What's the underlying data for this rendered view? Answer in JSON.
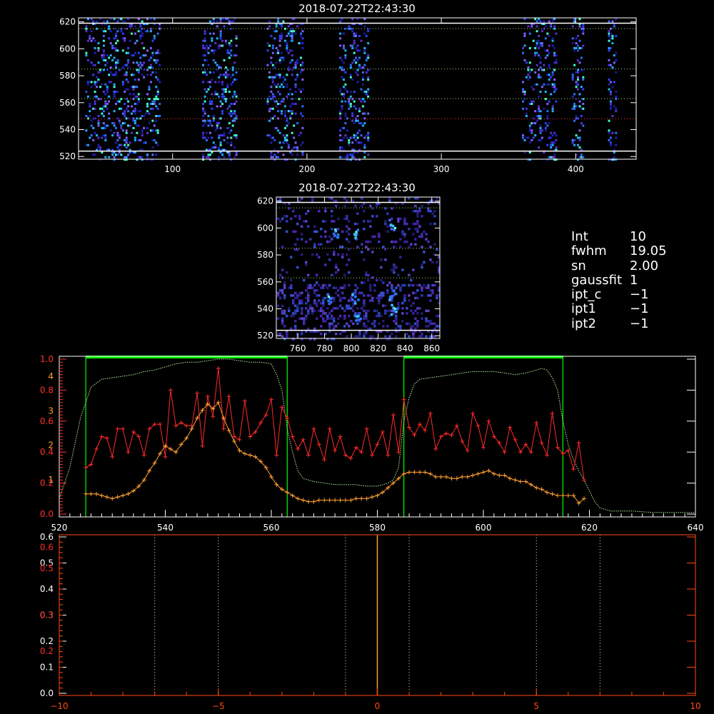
{
  "colors": {
    "background": "#000000",
    "frame": "#ffffff",
    "red_curve": "#ff2a2a",
    "orange_curve": "#ffa030",
    "green_curve": "#00ff00",
    "lower_frame": "#ff4a10"
  },
  "params": [
    {
      "name": "Int",
      "value": "10"
    },
    {
      "name": "fwhm",
      "value": "19.05"
    },
    {
      "name": "sn",
      "value": "2.00"
    },
    {
      "name": "gaussfit",
      "value": "1"
    },
    {
      "name": "ipt_c",
      "value": "−1"
    },
    {
      "name": "ipt1",
      "value": "−1"
    },
    {
      "name": "ipt2",
      "value": "−1"
    }
  ],
  "chart_data": [
    {
      "type": "heatmap",
      "title": "2018-07-22T22:43:30",
      "xlim": [
        30,
        445
      ],
      "ylim": [
        518,
        623
      ],
      "xticks": [
        100,
        200,
        300,
        400
      ],
      "yticks": [
        520,
        540,
        560,
        580,
        600,
        620
      ],
      "active_x_bands": [
        [
          35,
          90
        ],
        [
          122,
          148
        ],
        [
          170,
          197
        ],
        [
          224,
          245
        ],
        [
          360,
          385
        ],
        [
          397,
          405
        ],
        [
          424,
          430
        ]
      ],
      "hlines_solid": [
        524,
        619
      ],
      "hlines_dotted": [
        585,
        563,
        615
      ],
      "hline_red": 548
    },
    {
      "type": "heatmap",
      "title": "2018-07-22T22:43:30",
      "xlim": [
        744,
        866
      ],
      "ylim": [
        518,
        623
      ],
      "xticks": [
        760,
        780,
        800,
        820,
        840,
        860
      ],
      "yticks": [
        520,
        540,
        560,
        580,
        600,
        620
      ],
      "hlines_solid": [
        524,
        619
      ],
      "hlines_dotted": [
        585,
        563,
        615
      ]
    },
    {
      "type": "line",
      "xlim": [
        520,
        640
      ],
      "ylim": [
        0,
        1.0
      ],
      "xticks": [
        520,
        540,
        560,
        580,
        600,
        620,
        640
      ],
      "yticks_left_red": [
        "0.0",
        "0.2",
        "0.4",
        "0.6",
        "0.8",
        "1.0"
      ],
      "yticks_left_orange": [
        "1",
        "2",
        "3",
        "4"
      ],
      "box_ranges": [
        [
          525,
          563
        ],
        [
          585,
          615
        ]
      ],
      "red_x": [
        525,
        526,
        527,
        528,
        529,
        530,
        531,
        532,
        533,
        534,
        535,
        536,
        537,
        538,
        539,
        540,
        541,
        542,
        543,
        544,
        545,
        546,
        547,
        548,
        549,
        550,
        551,
        552,
        553,
        554,
        555,
        556,
        557,
        558,
        559,
        560,
        561,
        562,
        563,
        564,
        565,
        566,
        567,
        568,
        569,
        570,
        571,
        572,
        573,
        574,
        575,
        576,
        577,
        578,
        579,
        580,
        581,
        582,
        583,
        584,
        585,
        586,
        587,
        588,
        589,
        590,
        591,
        592,
        593,
        594,
        595,
        596,
        597,
        598,
        599,
        600,
        601,
        602,
        603,
        604,
        605,
        606,
        607,
        608,
        609,
        610,
        611,
        612,
        613,
        614,
        615,
        616,
        617,
        618,
        619
      ],
      "red_y": [
        0.3,
        0.32,
        0.42,
        0.5,
        0.49,
        0.37,
        0.55,
        0.55,
        0.4,
        0.53,
        0.5,
        0.38,
        0.55,
        0.58,
        0.58,
        0.37,
        0.8,
        0.57,
        0.59,
        0.57,
        0.57,
        0.78,
        0.44,
        0.76,
        0.63,
        0.94,
        0.55,
        0.76,
        0.5,
        0.48,
        0.73,
        0.5,
        0.53,
        0.59,
        0.64,
        0.74,
        0.38,
        0.69,
        0.62,
        0.5,
        0.42,
        0.48,
        0.38,
        0.55,
        0.45,
        0.35,
        0.55,
        0.41,
        0.5,
        0.38,
        0.36,
        0.43,
        0.4,
        0.55,
        0.38,
        0.45,
        0.53,
        0.38,
        0.64,
        0.4,
        0.74,
        0.56,
        0.51,
        0.58,
        0.54,
        0.65,
        0.42,
        0.5,
        0.52,
        0.51,
        0.57,
        0.47,
        0.41,
        0.65,
        0.57,
        0.43,
        0.6,
        0.5,
        0.46,
        0.4,
        0.56,
        0.48,
        0.4,
        0.45,
        0.4,
        0.59,
        0.46,
        0.38,
        0.65,
        0.43,
        0.39,
        0.41,
        0.29,
        0.46,
        0.22,
        0.38
      ],
      "orange_x": [
        525,
        526,
        527,
        528,
        529,
        530,
        531,
        532,
        533,
        534,
        535,
        536,
        537,
        538,
        539,
        540,
        541,
        542,
        543,
        544,
        545,
        546,
        547,
        548,
        549,
        550,
        551,
        552,
        553,
        554,
        555,
        556,
        557,
        558,
        559,
        560,
        561,
        562,
        563,
        564,
        565,
        566,
        567,
        568,
        569,
        570,
        571,
        572,
        573,
        574,
        575,
        576,
        577,
        578,
        579,
        580,
        581,
        582,
        583,
        584,
        585,
        586,
        587,
        588,
        589,
        590,
        591,
        592,
        593,
        594,
        595,
        596,
        597,
        598,
        599,
        600,
        601,
        602,
        603,
        604,
        605,
        606,
        607,
        608,
        609,
        610,
        611,
        612,
        613,
        614,
        615,
        616,
        617,
        618,
        619
      ],
      "orange_y": [
        0.13,
        0.13,
        0.13,
        0.12,
        0.11,
        0.1,
        0.11,
        0.12,
        0.13,
        0.15,
        0.18,
        0.22,
        0.28,
        0.33,
        0.39,
        0.44,
        0.42,
        0.4,
        0.45,
        0.49,
        0.55,
        0.62,
        0.67,
        0.71,
        0.68,
        0.72,
        0.62,
        0.54,
        0.47,
        0.41,
        0.39,
        0.38,
        0.37,
        0.34,
        0.3,
        0.24,
        0.19,
        0.16,
        0.14,
        0.12,
        0.1,
        0.09,
        0.08,
        0.08,
        0.09,
        0.09,
        0.09,
        0.09,
        0.09,
        0.09,
        0.09,
        0.1,
        0.1,
        0.1,
        0.11,
        0.12,
        0.14,
        0.17,
        0.2,
        0.23,
        0.26,
        0.27,
        0.27,
        0.27,
        0.27,
        0.26,
        0.24,
        0.24,
        0.24,
        0.23,
        0.23,
        0.24,
        0.24,
        0.25,
        0.26,
        0.27,
        0.28,
        0.26,
        0.25,
        0.25,
        0.23,
        0.22,
        0.21,
        0.21,
        0.19,
        0.17,
        0.16,
        0.14,
        0.13,
        0.12,
        0.12,
        0.12,
        0.12,
        0.07,
        0.1
      ],
      "green_x": [
        520,
        522,
        524,
        526,
        528,
        530,
        532,
        534,
        536,
        538,
        540,
        542,
        544,
        546,
        548,
        550,
        552,
        554,
        556,
        558,
        560,
        561,
        562,
        563,
        564,
        565,
        566,
        568,
        570,
        572,
        574,
        576,
        578,
        580,
        582,
        583,
        584,
        585,
        586,
        587,
        588,
        590,
        592,
        594,
        596,
        598,
        600,
        602,
        604,
        606,
        608,
        610,
        611,
        612,
        613,
        614,
        615,
        616,
        617,
        618,
        619,
        620,
        621,
        622,
        624,
        628,
        632,
        636,
        640
      ],
      "green_y": [
        0.1,
        0.3,
        0.62,
        0.82,
        0.87,
        0.88,
        0.89,
        0.9,
        0.92,
        0.93,
        0.95,
        0.97,
        0.98,
        0.98,
        0.99,
        1.0,
        1.0,
        0.99,
        0.98,
        0.98,
        0.97,
        0.9,
        0.8,
        0.55,
        0.4,
        0.28,
        0.23,
        0.21,
        0.2,
        0.19,
        0.19,
        0.19,
        0.18,
        0.18,
        0.2,
        0.22,
        0.3,
        0.6,
        0.75,
        0.84,
        0.87,
        0.88,
        0.89,
        0.9,
        0.91,
        0.92,
        0.92,
        0.92,
        0.91,
        0.9,
        0.91,
        0.93,
        0.94,
        0.93,
        0.88,
        0.8,
        0.6,
        0.45,
        0.35,
        0.28,
        0.22,
        0.15,
        0.08,
        0.04,
        0.02,
        0.02,
        0.01,
        0.01,
        0.01
      ]
    },
    {
      "type": "line",
      "xlim": [
        -10,
        10
      ],
      "ylim": [
        0,
        0.6
      ],
      "xticks": [
        "−10",
        "−5",
        "0",
        "5",
        "10"
      ],
      "xtick_values": [
        -10,
        -5,
        0,
        5,
        10
      ],
      "yticks_white": [
        "0.0",
        "0.1",
        "0.2",
        "0.3",
        "0.4",
        "0.5",
        "0.6"
      ],
      "yticks_red": [
        "0.2",
        "0.3",
        "0.6",
        "0.5"
      ],
      "vlines_dotted": [
        -7,
        -5,
        -1,
        1,
        5,
        7
      ],
      "vline_orange": 0
    }
  ]
}
